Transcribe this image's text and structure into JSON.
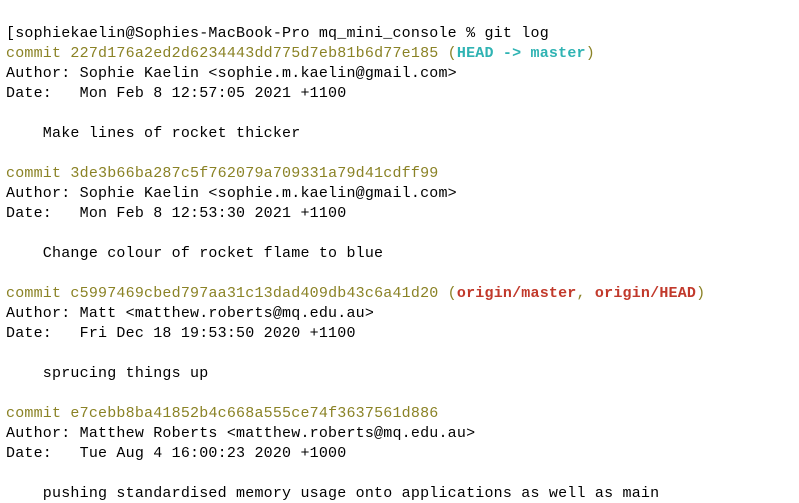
{
  "prompt_line": {
    "open_bracket": "[",
    "prompt": "sophiekaelin@Sophies-MacBook-Pro mq_mini_console % ",
    "command": "git log"
  },
  "commits": [
    {
      "hash_label": "commit ",
      "hash": "227d176a2ed2d6234443dd775d7eb81b6d77e185",
      "refs_open": " (",
      "head_arrow": "HEAD -> ",
      "branch": "master",
      "refs_close": ")",
      "author_line": "Author: Sophie Kaelin <sophie.m.kaelin@gmail.com>",
      "date_line": "Date:   Mon Feb 8 12:57:05 2021 +1100",
      "message": "    Make lines of rocket thicker"
    },
    {
      "hash_label": "commit ",
      "hash": "3de3b66ba287c5f762079a709331a79d41cdff99",
      "author_line": "Author: Sophie Kaelin <sophie.m.kaelin@gmail.com>",
      "date_line": "Date:   Mon Feb 8 12:53:30 2021 +1100",
      "message": "    Change colour of rocket flame to blue"
    },
    {
      "hash_label": "commit ",
      "hash": "c5997469cbed797aa31c13dad409db43c6a41d20",
      "refs_open": " (",
      "ref1": "origin/master",
      "refs_sep": ", ",
      "ref2": "origin/HEAD",
      "refs_close": ")",
      "author_line": "Author: Matt <matthew.roberts@mq.edu.au>",
      "date_line": "Date:   Fri Dec 18 19:53:50 2020 +1100",
      "message": "    sprucing things up"
    },
    {
      "hash_label": "commit ",
      "hash": "e7cebb8ba41852b4c668a555ce74f3637561d886",
      "author_line": "Author: Matthew Roberts <matthew.roberts@mq.edu.au>",
      "date_line": "Date:   Tue Aug 4 16:00:23 2020 +1000",
      "message": "    pushing standardised memory usage onto applications as well as main"
    }
  ]
}
